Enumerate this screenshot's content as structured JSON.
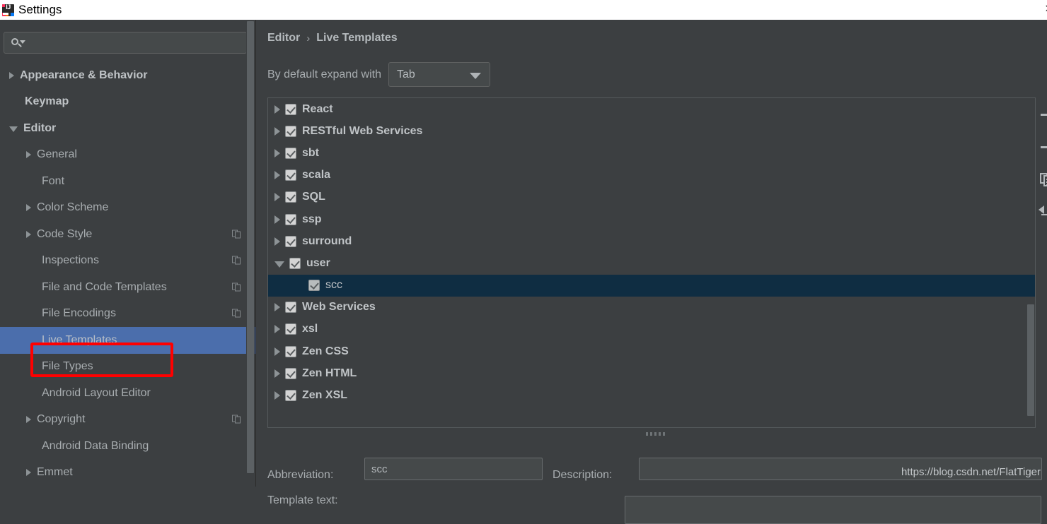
{
  "window": {
    "title": "Settings",
    "app_icon": "intellij-idea-icon",
    "close_label": "›"
  },
  "sidebar": {
    "search": {
      "value": "",
      "placeholder": "",
      "icon": "search-icon"
    },
    "items": [
      {
        "label": "Appearance & Behavior",
        "level": 0,
        "twisty": "collapsed",
        "bold": true,
        "selected": false,
        "badge": false
      },
      {
        "label": "Keymap",
        "level": 0,
        "twisty": "none",
        "bold": true,
        "selected": false,
        "badge": false
      },
      {
        "label": "Editor",
        "level": 0,
        "twisty": "expanded",
        "bold": true,
        "selected": false,
        "badge": false
      },
      {
        "label": "General",
        "level": 1,
        "twisty": "collapsed",
        "bold": false,
        "selected": false,
        "badge": false
      },
      {
        "label": "Font",
        "level": 1,
        "twisty": "none",
        "bold": false,
        "selected": false,
        "badge": false
      },
      {
        "label": "Color Scheme",
        "level": 1,
        "twisty": "collapsed",
        "bold": false,
        "selected": false,
        "badge": false
      },
      {
        "label": "Code Style",
        "level": 1,
        "twisty": "collapsed",
        "bold": false,
        "selected": false,
        "badge": true
      },
      {
        "label": "Inspections",
        "level": 1,
        "twisty": "none",
        "bold": false,
        "selected": false,
        "badge": true
      },
      {
        "label": "File and Code Templates",
        "level": 1,
        "twisty": "none",
        "bold": false,
        "selected": false,
        "badge": true
      },
      {
        "label": "File Encodings",
        "level": 1,
        "twisty": "none",
        "bold": false,
        "selected": false,
        "badge": true
      },
      {
        "label": "Live Templates",
        "level": 1,
        "twisty": "none",
        "bold": false,
        "selected": true,
        "badge": false
      },
      {
        "label": "File Types",
        "level": 1,
        "twisty": "none",
        "bold": false,
        "selected": false,
        "badge": false
      },
      {
        "label": "Android Layout Editor",
        "level": 1,
        "twisty": "none",
        "bold": false,
        "selected": false,
        "badge": false
      },
      {
        "label": "Copyright",
        "level": 1,
        "twisty": "collapsed",
        "bold": false,
        "selected": false,
        "badge": true
      },
      {
        "label": "Android Data Binding",
        "level": 1,
        "twisty": "none",
        "bold": false,
        "selected": false,
        "badge": false
      },
      {
        "label": "Emmet",
        "level": 1,
        "twisty": "collapsed",
        "bold": false,
        "selected": false,
        "badge": false
      }
    ]
  },
  "annotation": {
    "shape": "rectangle",
    "color": "#ff0000",
    "target": "Live Templates"
  },
  "main": {
    "breadcrumb": {
      "parent": "Editor",
      "separator": "›",
      "current": "Live Templates"
    },
    "expand_with": {
      "label": "By default expand with",
      "value": "Tab"
    },
    "templates": [
      {
        "label": "React",
        "level": 0,
        "twisty": "collapsed",
        "checked": true,
        "selected": false
      },
      {
        "label": "RESTful Web Services",
        "level": 0,
        "twisty": "collapsed",
        "checked": true,
        "selected": false
      },
      {
        "label": "sbt",
        "level": 0,
        "twisty": "collapsed",
        "checked": true,
        "selected": false
      },
      {
        "label": "scala",
        "level": 0,
        "twisty": "collapsed",
        "checked": true,
        "selected": false
      },
      {
        "label": "SQL",
        "level": 0,
        "twisty": "collapsed",
        "checked": true,
        "selected": false
      },
      {
        "label": "ssp",
        "level": 0,
        "twisty": "collapsed",
        "checked": true,
        "selected": false
      },
      {
        "label": "surround",
        "level": 0,
        "twisty": "collapsed",
        "checked": true,
        "selected": false
      },
      {
        "label": "user",
        "level": 0,
        "twisty": "expanded",
        "checked": true,
        "selected": false
      },
      {
        "label": "scc",
        "level": 1,
        "twisty": "none",
        "checked": true,
        "selected": true
      },
      {
        "label": "Web Services",
        "level": 0,
        "twisty": "collapsed",
        "checked": true,
        "selected": false
      },
      {
        "label": "xsl",
        "level": 0,
        "twisty": "collapsed",
        "checked": true,
        "selected": false
      },
      {
        "label": "Zen CSS",
        "level": 0,
        "twisty": "collapsed",
        "checked": true,
        "selected": false
      },
      {
        "label": "Zen HTML",
        "level": 0,
        "twisty": "collapsed",
        "checked": true,
        "selected": false
      },
      {
        "label": "Zen XSL",
        "level": 0,
        "twisty": "collapsed",
        "checked": true,
        "selected": false
      }
    ],
    "toolbar": [
      {
        "icon": "plus-icon",
        "name": "add-template-button"
      },
      {
        "icon": "minus-icon",
        "name": "remove-template-button"
      },
      {
        "icon": "duplicate-icon",
        "name": "duplicate-template-button"
      },
      {
        "icon": "revert-icon",
        "name": "revert-template-button"
      }
    ],
    "form": {
      "abbreviation_label": "Abbreviation:",
      "abbreviation_value": "scc",
      "description_label": "Description:",
      "description_value": "",
      "template_text_label": "Template text:"
    }
  },
  "watermark": "https://blog.csdn.net/FlatTiger",
  "colors": {
    "window_bg": "#3c3f41",
    "titlebar_bg": "#ffffff",
    "sidebar_selection": "#4b6eac",
    "list_selection": "#0f2d42",
    "annotation": "#ff0000",
    "text": "#a8adb0"
  }
}
